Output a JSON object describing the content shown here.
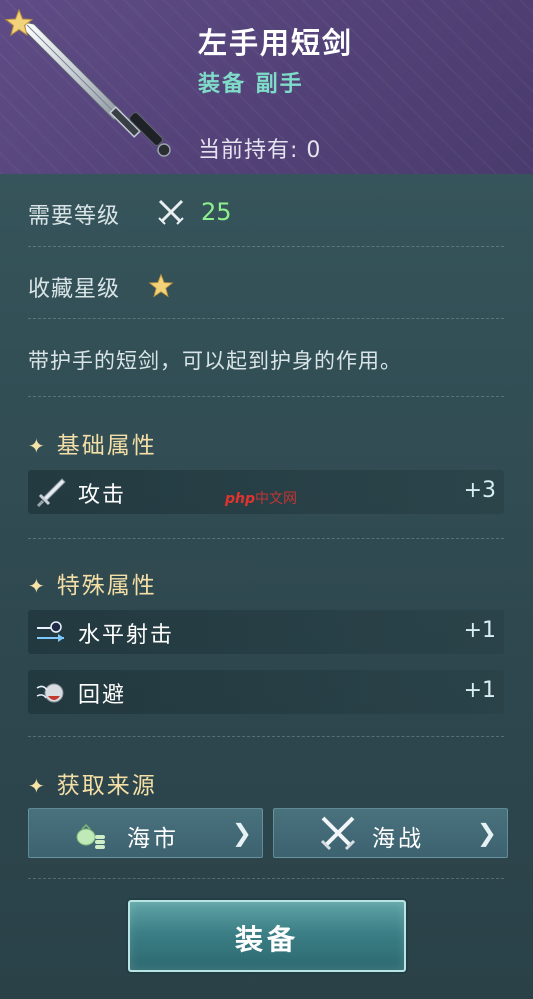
{
  "header": {
    "item_name": "左手用短剑",
    "item_type": "装备 副手",
    "owned_label": "当前持有:",
    "owned_count": "0",
    "corner_icon": "star-icon",
    "art_icon": "short-sword-icon"
  },
  "requirements": {
    "level_label": "需要等级",
    "level_icon": "crossed-swords-icon",
    "level_value": "25",
    "rank_label": "收藏星级",
    "rank_stars": 1,
    "description": "带护手的短剑，可以起到护身的作用。"
  },
  "sections": {
    "base_title": "基础属性",
    "special_title": "特殊属性",
    "source_title": "获取来源"
  },
  "base_stats": [
    {
      "icon": "sword-icon",
      "name": "攻击",
      "value": "+3"
    }
  ],
  "special_stats": [
    {
      "icon": "horizontal-shot-icon",
      "name": "水平射击",
      "value": "+1"
    },
    {
      "icon": "dodge-icon",
      "name": "回避",
      "value": "+1"
    }
  ],
  "sources": [
    {
      "icon": "coin-bag-icon",
      "label": "海市"
    },
    {
      "icon": "crossed-swords-icon",
      "label": "海战"
    }
  ],
  "equip_button": {
    "label": "装备"
  },
  "watermark": {
    "brand": "php",
    "site": "中文网"
  },
  "colors": {
    "header_bg": "#584680",
    "panel_bg": "#33505a",
    "accent_teal": "#7fdcc8",
    "level_green": "#8ef08c",
    "section_gold": "#f4dfa6"
  }
}
